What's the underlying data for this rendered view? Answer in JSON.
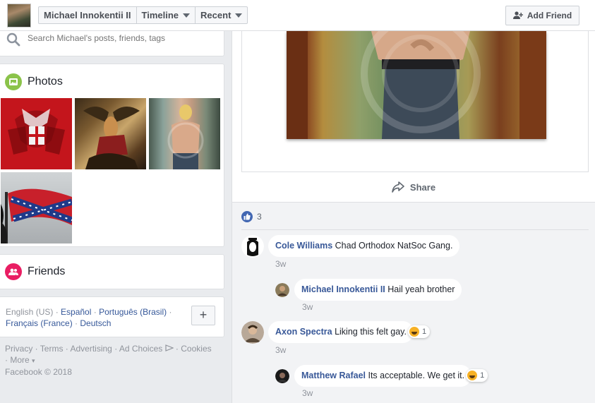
{
  "header": {
    "profile_name": "Michael Innokentii II",
    "timeline_label": "Timeline",
    "recent_label": "Recent",
    "add_friend_label": "Add Friend"
  },
  "search": {
    "placeholder": "Search Michael's posts, friends, tags"
  },
  "photos": {
    "title": "Photos"
  },
  "friends": {
    "title": "Friends"
  },
  "languages": {
    "current": "English (US)",
    "items": [
      "Español",
      "Português (Brasil)",
      "Français (France)",
      "Deutsch"
    ],
    "more_label": "+"
  },
  "footer": {
    "links": [
      "Privacy",
      "Terms",
      "Advertising",
      "Ad Choices",
      "Cookies",
      "More"
    ],
    "copyright": "Facebook © 2018"
  },
  "post": {
    "share_label": "Share",
    "like_count": "3"
  },
  "comments": [
    {
      "author": "Cole Williams",
      "text": "Chad Orthodox NatSoc Gang.",
      "time": "3w"
    },
    {
      "author": "Michael Innokentii II",
      "text": "Hail yeah brother",
      "time": "3w"
    },
    {
      "author": "Axon Spectra",
      "text": "Liking this felt gay.",
      "time": "3w",
      "reaction_count": "1"
    },
    {
      "author": "Matthew Rafael",
      "text": "Its acceptable. We get it.",
      "time": "3w",
      "reaction_count": "1"
    }
  ],
  "colors": {
    "link": "#385898",
    "brand": "#4267b2",
    "photos_icon": "#8bc34a",
    "friends_icon": "#e91e63"
  }
}
